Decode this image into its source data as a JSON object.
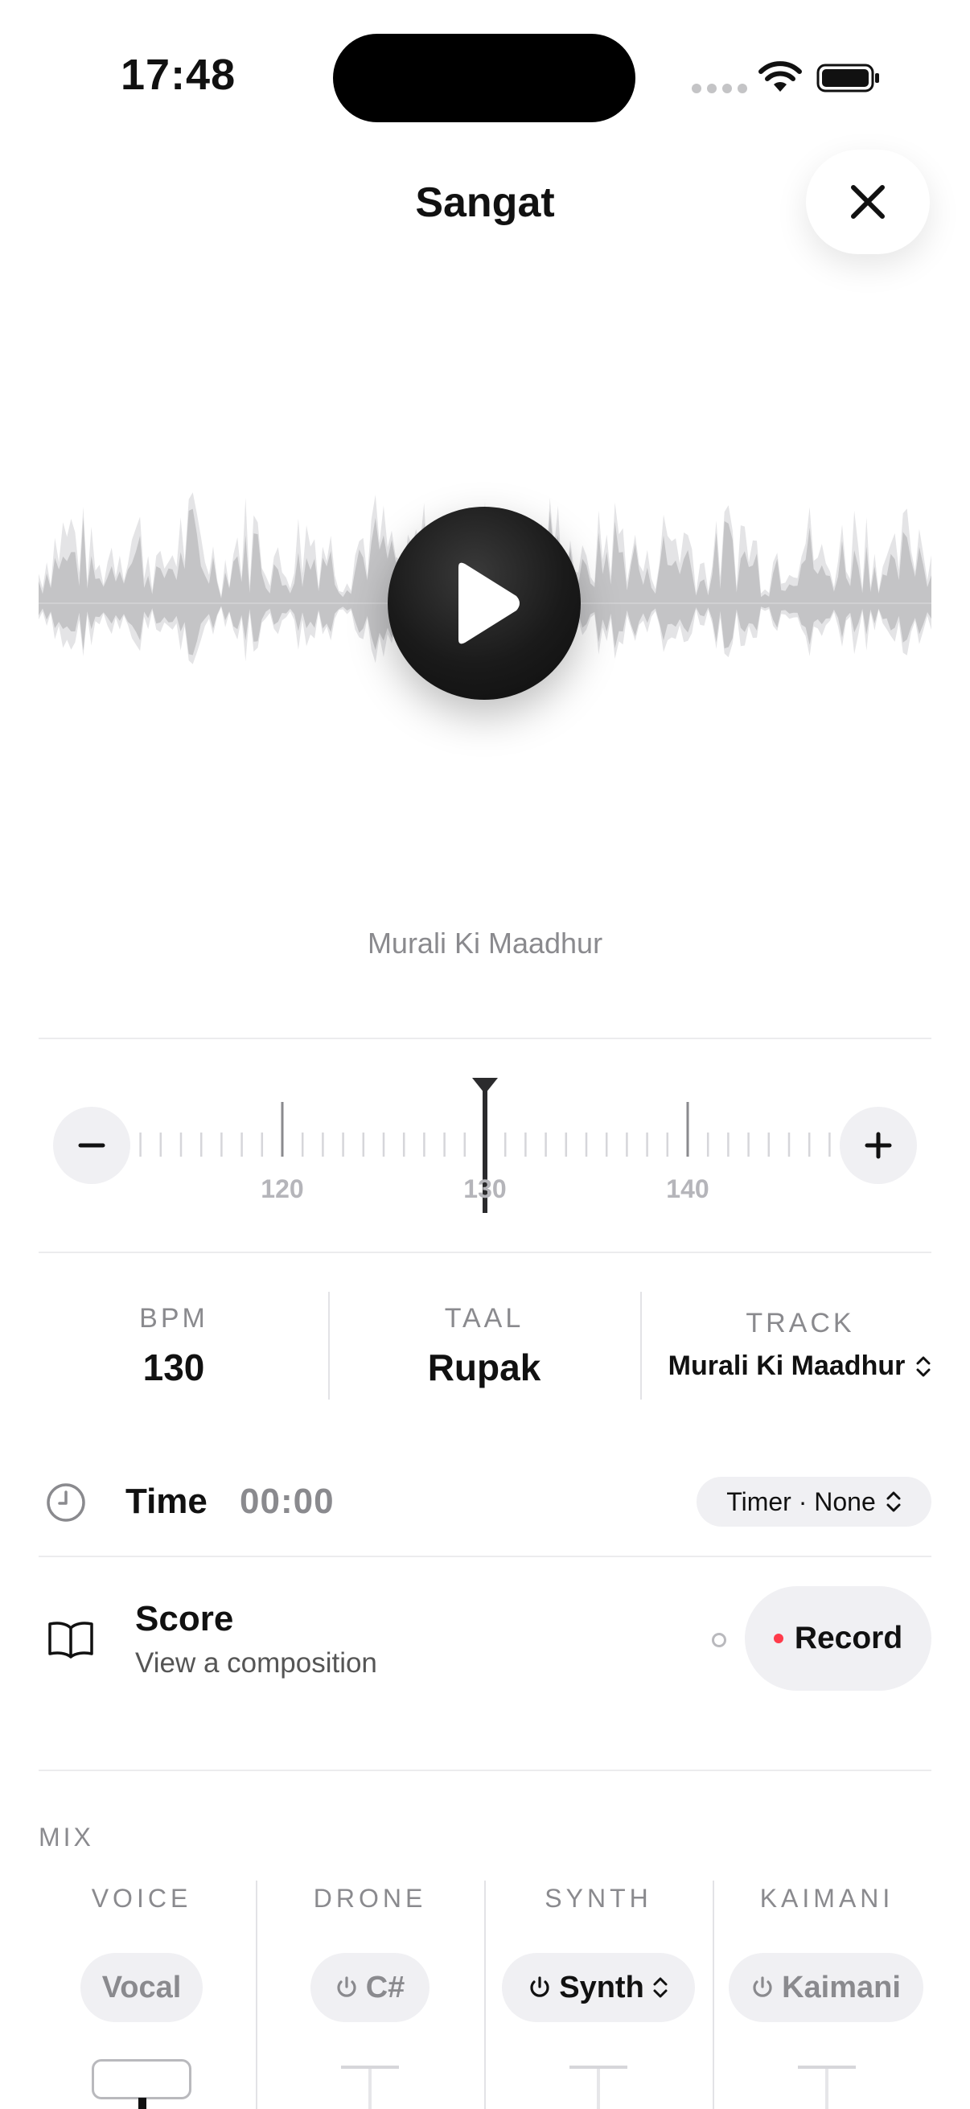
{
  "status_bar": {
    "time": "17:48"
  },
  "header": {
    "title": "Sangat"
  },
  "player": {
    "track_caption": "Murali Ki Maadhur"
  },
  "tempo": {
    "ticks": [
      "120",
      "130",
      "140"
    ],
    "selected_bpm": 130
  },
  "stats": [
    {
      "label": "BPM",
      "value": "130"
    },
    {
      "label": "TAAL",
      "value": "Rupak"
    },
    {
      "label": "TRACK",
      "value": "Murali Ki Maadhur"
    }
  ],
  "time_row": {
    "label": "Time",
    "value": "00:00",
    "timer_button": "Timer · None"
  },
  "score_row": {
    "title": "Score",
    "subtitle": "View a composition",
    "record_label": "Record"
  },
  "mix": {
    "label": "MIX",
    "channels": [
      {
        "label": "VOICE",
        "pill": "Vocal"
      },
      {
        "label": "DRONE",
        "pill": "C#"
      },
      {
        "label": "SYNTH",
        "pill": "Synth"
      },
      {
        "label": "KAIMANI",
        "pill": "Kaimani"
      }
    ]
  },
  "colors": {
    "accent_record": "#ff3b4a",
    "muted_text": "#8a8a8e",
    "pill_bg": "#f0f0f3"
  }
}
